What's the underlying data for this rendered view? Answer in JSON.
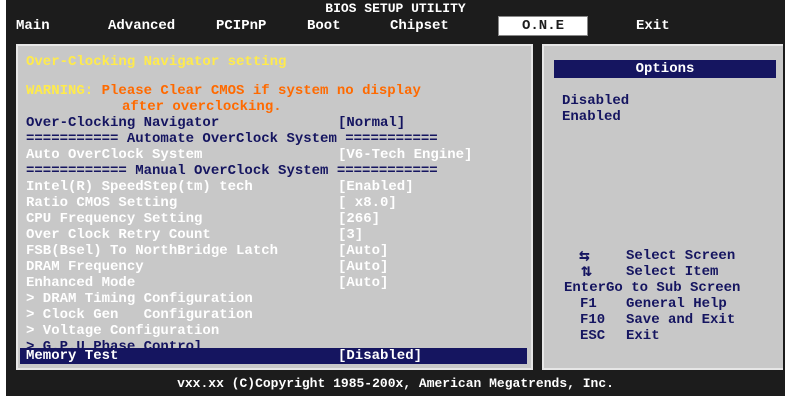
{
  "title": "BIOS SETUP UTILITY",
  "menu": {
    "items": [
      "Main",
      "Advanced",
      "PCIPnP",
      "Boot",
      "Chipset",
      "O.N.E",
      "Exit"
    ],
    "active": "O.N.E"
  },
  "main": {
    "header": "Over-Clocking Navigator setting",
    "warning_label": "WARNING:",
    "warning_line1": "Please Clear CMOS if system no display",
    "warning_line2": "after overclocking.",
    "rows": [
      {
        "label": "Over-Clocking Navigator",
        "value": "[Normal]"
      },
      {
        "label": "=========== Automate OverClock System ===========",
        "value": ""
      },
      {
        "label": "Auto OverClock System",
        "value": "[V6-Tech Engine]"
      },
      {
        "label": "============ Manual OverClock System ============",
        "value": ""
      },
      {
        "label": "Intel(R) SpeedStep(tm) tech",
        "value": "[Enabled]"
      },
      {
        "label": "Ratio CMOS Setting",
        "value": "[ x8.0]"
      },
      {
        "label": "CPU Frequency Setting",
        "value": "[266]"
      },
      {
        "label": "Over Clock Retry Count",
        "value": "[3]"
      },
      {
        "label": "FSB(Bsel) To NorthBridge Latch",
        "value": "[Auto]"
      },
      {
        "label": "DRAM Frequency",
        "value": "[Auto]"
      },
      {
        "label": "Enhanced Mode",
        "value": "[Auto]"
      },
      {
        "label": "> DRAM Timing Configuration",
        "value": ""
      },
      {
        "label": "> Clock Gen   Configuration",
        "value": ""
      },
      {
        "label": "> Voltage Configuration",
        "value": ""
      },
      {
        "label": "> G.P.U Phase Control",
        "value": ""
      },
      {
        "label": "Memory Test",
        "value": "[Disabled]"
      }
    ]
  },
  "side": {
    "options_title": "Options",
    "options": [
      "Disabled",
      "Enabled"
    ],
    "help": [
      {
        "key": "",
        "text": "Select Screen",
        "icon": "left-right-arrows-icon"
      },
      {
        "key": "",
        "text": "Select Item",
        "icon": "up-down-arrows-icon"
      },
      {
        "key": "Enter",
        "text": "Go to Sub Screen"
      },
      {
        "key": "F1",
        "text": "General Help"
      },
      {
        "key": "F10",
        "text": "Save and Exit"
      },
      {
        "key": "ESC",
        "text": "Exit"
      }
    ]
  },
  "footer": "vxx.xx (C)Copyright 1985-200x, American Megatrends, Inc.",
  "colors": {
    "background": "#1c1c1c",
    "panel": "#c8c8c8",
    "navy": "#151560",
    "warning": "#ff6a00",
    "header": "#ffeb4b"
  }
}
